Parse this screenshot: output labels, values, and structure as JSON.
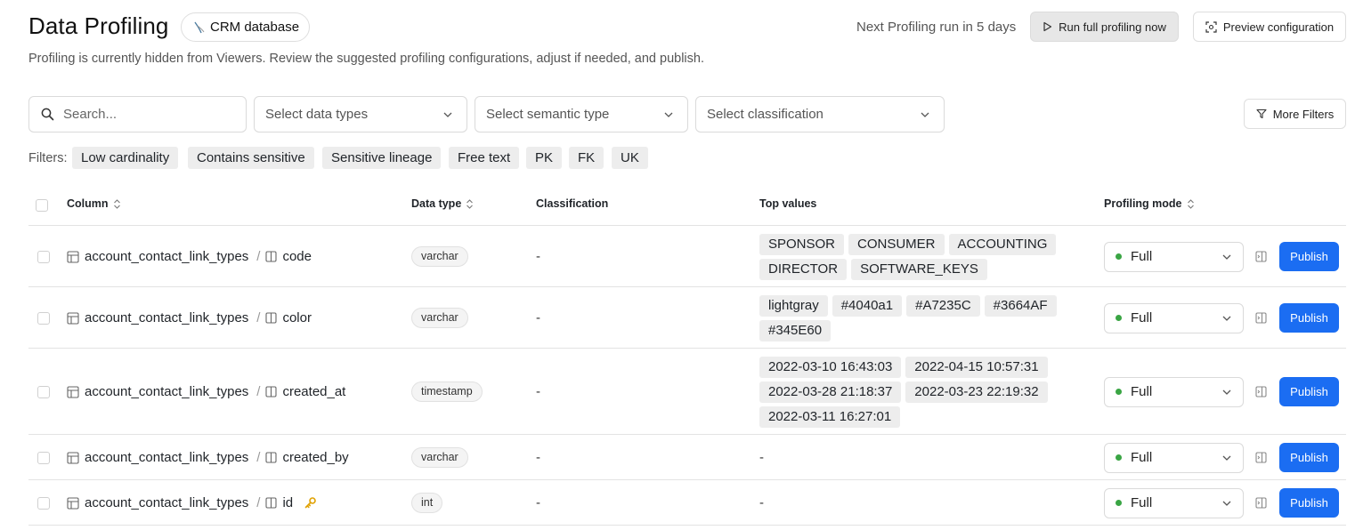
{
  "header": {
    "title": "Data Profiling",
    "database_chip": "CRM database",
    "subtitle": "Profiling is currently hidden from Viewers. Review the suggested profiling configurations, adjust if needed, and publish.",
    "next_run": "Next Profiling run in 5 days",
    "run_button": "Run full profiling now",
    "preview_button": "Preview configuration"
  },
  "toolbar": {
    "search_placeholder": "Search...",
    "data_types_placeholder": "Select data types",
    "semantic_type_placeholder": "Select semantic type",
    "classification_placeholder": "Select classification",
    "more_filters": "More Filters"
  },
  "filters": {
    "label": "Filters:",
    "chips": [
      "Low cardinality",
      "Contains sensitive",
      "Sensitive lineage",
      "Free text",
      "PK",
      "FK",
      "UK"
    ]
  },
  "table": {
    "headers": {
      "column": "Column",
      "data_type": "Data type",
      "classification": "Classification",
      "top_values": "Top values",
      "profiling_mode": "Profiling mode"
    },
    "rows": [
      {
        "table": "account_contact_link_types",
        "column": "code",
        "data_type": "varchar",
        "classification": "-",
        "top_values": [
          "SPONSOR",
          "CONSUMER",
          "ACCOUNTING",
          "DIRECTOR",
          "SOFTWARE_KEYS"
        ],
        "mode": "Full",
        "publish": "Publish",
        "key_icon": false
      },
      {
        "table": "account_contact_link_types",
        "column": "color",
        "data_type": "varchar",
        "classification": "-",
        "top_values": [
          "lightgray",
          "#4040a1",
          "#A7235C",
          "#3664AF",
          "#345E60"
        ],
        "mode": "Full",
        "publish": "Publish",
        "key_icon": false
      },
      {
        "table": "account_contact_link_types",
        "column": "created_at",
        "data_type": "timestamp",
        "classification": "-",
        "top_values": [
          "2022-03-10 16:43:03",
          "2022-04-15 10:57:31",
          "2022-03-28 21:18:37",
          "2022-03-23 22:19:32",
          "2022-03-11 16:27:01"
        ],
        "mode": "Full",
        "publish": "Publish",
        "key_icon": false
      },
      {
        "table": "account_contact_link_types",
        "column": "created_by",
        "data_type": "varchar",
        "classification": "-",
        "top_values_empty": "-",
        "mode": "Full",
        "publish": "Publish",
        "key_icon": false
      },
      {
        "table": "account_contact_link_types",
        "column": "id",
        "data_type": "int",
        "classification": "-",
        "top_values_empty": "-",
        "mode": "Full",
        "publish": "Publish",
        "key_icon": true
      }
    ]
  },
  "colors": {
    "primary": "#1b6df2",
    "status_full": "#3aa544",
    "key_icon": "#e0a100"
  }
}
